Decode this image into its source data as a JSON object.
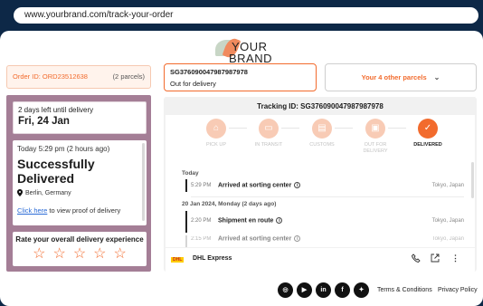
{
  "browser": {
    "url": "www.yourbrand.com/track-your-order"
  },
  "brand": {
    "line1": "YOUR",
    "line2": "BRAND"
  },
  "order": {
    "id_label": "Order ID: ORD23512638",
    "parcels": "(2 parcels)"
  },
  "summary": {
    "days_left": "2 days left until delivery",
    "date": "Fri, 24 Jan",
    "time": "Today 5:29 pm (2 hours ago)",
    "status_line1": "Successfully",
    "status_line2": "Delivered",
    "location": "Berlin, Germany",
    "proof_link": "Click here",
    "proof_text": " to view proof of delivery"
  },
  "rating": {
    "title": "Rate your overall delivery experience",
    "stars": 5
  },
  "selected_parcel": {
    "tracking_number": "SG376090047987987978",
    "status": "Out for delivery"
  },
  "other_parcels": {
    "label": "Your 4 other parcels"
  },
  "tracking": {
    "id_label": "Tracking ID: SG376090047987987978",
    "steps": [
      {
        "label": "PICK UP",
        "icon": "pickup-icon",
        "active": false
      },
      {
        "label": "IN TRANSIT",
        "icon": "truck-icon",
        "active": false
      },
      {
        "label": "CUSTOMS",
        "icon": "customs-icon",
        "active": false
      },
      {
        "label": "OUT FOR DELIVERY",
        "icon": "out-for-delivery-icon",
        "active": false
      },
      {
        "label": "DELIVERED",
        "icon": "check-icon",
        "active": true
      }
    ],
    "events": {
      "day1": "Today",
      "e1_time": "5:29 PM",
      "e1_status": "Arrived at sorting center",
      "e1_loc": "Tokyo, Japan",
      "day2": "20 Jan 2024, Monday (2 days ago)",
      "e2_time": "2:20 PM",
      "e2_status": "Shipment en route",
      "e2_loc": "Tokyo, Japan",
      "e3_time": "2:15 PM",
      "e3_status": "Arrived at sorting center",
      "e3_loc": "Tokyo, Japan"
    }
  },
  "courier": {
    "logo_text": "DHL",
    "name": "DHL Express"
  },
  "footer": {
    "social": [
      "instagram-icon",
      "youtube-icon",
      "linkedin-icon",
      "facebook-icon",
      "twitter-icon"
    ],
    "terms": "Terms & Conditions",
    "privacy": "Privacy Policy"
  },
  "colors": {
    "accent": "#f26b2d",
    "accent_light": "#f8cbb5",
    "panel": "#a47e96",
    "dark_bg": "#0d2847"
  }
}
